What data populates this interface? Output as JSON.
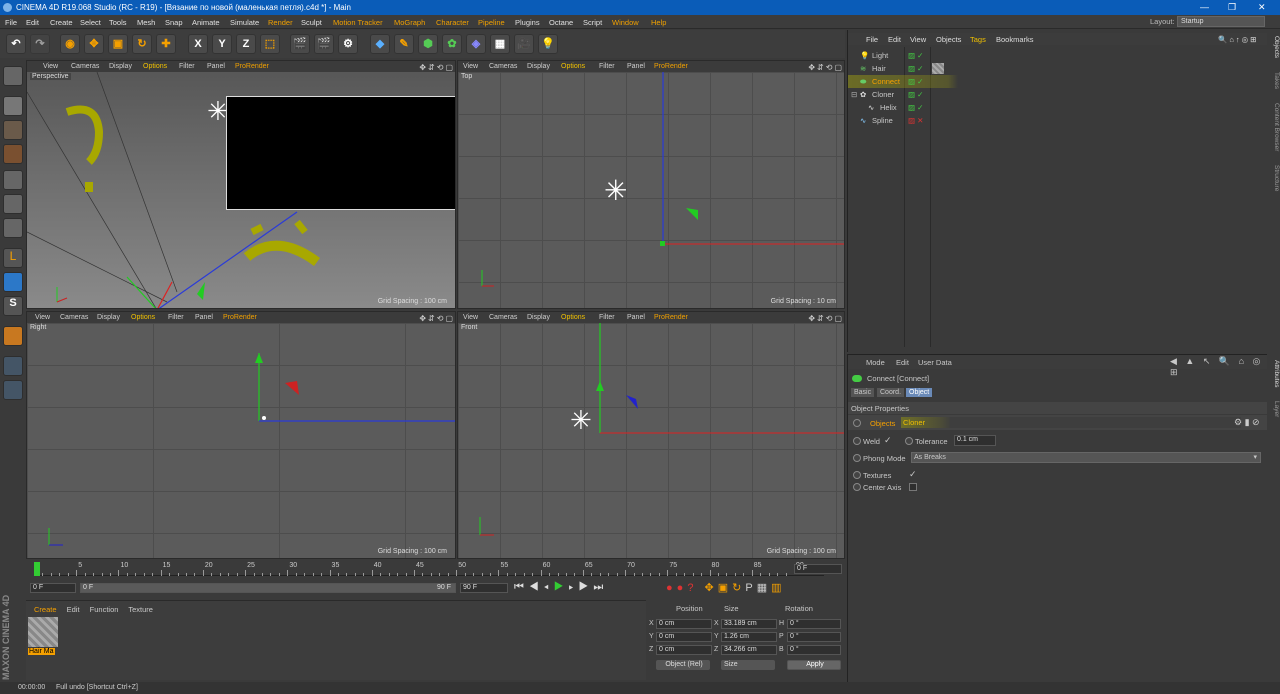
{
  "window": {
    "title": "CINEMA 4D R19.068 Studio (RC - R19) - [Вязание по новой (маленькая петля).c4d *] - Main",
    "controls": [
      "—",
      "❐",
      "✕"
    ]
  },
  "menubar": {
    "items": [
      "File",
      "Edit",
      "Create",
      "Select",
      "Tools",
      "Mesh",
      "Snap",
      "Animate",
      "Simulate",
      "Render",
      "Sculpt",
      "Motion Tracker",
      "MoGraph",
      "Character",
      "Pipeline",
      "Plugins",
      "Octane",
      "Script",
      "Window",
      "Help"
    ],
    "layout_label": "Layout:",
    "layout_value": "Startup"
  },
  "toolbar": {
    "axis_labels": [
      "X",
      "Y",
      "Z"
    ]
  },
  "viewports": [
    {
      "name": "Perspective",
      "menu": [
        "View",
        "Cameras",
        "Display",
        "Options",
        "Filter",
        "Panel",
        "ProRender"
      ],
      "grid_spacing": "Grid Spacing : 100 cm"
    },
    {
      "name": "Top",
      "menu": [
        "View",
        "Cameras",
        "Display",
        "Options",
        "Filter",
        "Panel",
        "ProRender"
      ],
      "grid_spacing": "Grid Spacing : 10 cm"
    },
    {
      "name": "Right",
      "menu": [
        "View",
        "Cameras",
        "Display",
        "Options",
        "Filter",
        "Panel",
        "ProRender"
      ],
      "grid_spacing": "Grid Spacing : 100 cm"
    },
    {
      "name": "Front",
      "menu": [
        "View",
        "Cameras",
        "Display",
        "Options",
        "Filter",
        "Panel",
        "ProRender"
      ],
      "grid_spacing": "Grid Spacing : 100 cm"
    }
  ],
  "timeline": {
    "ticks": [
      "0",
      "5",
      "10",
      "15",
      "20",
      "25",
      "30",
      "35",
      "40",
      "45",
      "50",
      "55",
      "60",
      "65",
      "70",
      "75",
      "80",
      "85",
      "90"
    ],
    "current_frame": "0 F",
    "start": "0 F",
    "start2": "0 F",
    "end": "90 F",
    "end2": "90 F"
  },
  "material_manager": {
    "menu": [
      "Create",
      "Edit",
      "Function",
      "Texture"
    ],
    "materials": [
      {
        "name": "Hair Ma"
      }
    ]
  },
  "coordinates": {
    "headers": [
      "Position",
      "Size",
      "Rotation"
    ],
    "rows": [
      {
        "axis": "X",
        "pos": "0 cm",
        "saxis": "X",
        "size": "33.189 cm",
        "raxis": "H",
        "rot": "0 °"
      },
      {
        "axis": "Y",
        "pos": "0 cm",
        "saxis": "Y",
        "size": "1.26 cm",
        "raxis": "P",
        "rot": "0 °"
      },
      {
        "axis": "Z",
        "pos": "0 cm",
        "saxis": "Z",
        "size": "34.266 cm",
        "raxis": "B",
        "rot": "0 °"
      }
    ],
    "mode": "Object (Rel)",
    "size_mode": "Size",
    "apply": "Apply"
  },
  "object_manager": {
    "menu": [
      "File",
      "Edit",
      "View",
      "Objects",
      "Tags",
      "Bookmarks"
    ],
    "objects": [
      {
        "name": "Light"
      },
      {
        "name": "Hair"
      },
      {
        "name": "Connect"
      },
      {
        "name": "Cloner"
      },
      {
        "name": "Helix"
      },
      {
        "name": "Spline"
      }
    ]
  },
  "attributes": {
    "menu": [
      "Mode",
      "Edit",
      "User Data"
    ],
    "object_title": "Connect [Connect]",
    "tabs": [
      "Basic",
      "Coord.",
      "Object"
    ],
    "section": "Object Properties",
    "objects_label": "Objects",
    "objects_value": "Cloner",
    "weld_label": "Weld",
    "weld_check": "✓",
    "tolerance_label": "Tolerance",
    "tolerance_value": "0.1 cm",
    "phong_label": "Phong Mode",
    "phong_value": "As Breaks",
    "textures_label": "Textures",
    "textures_check": "✓",
    "center_axis_label": "Center Axis"
  },
  "side_tabs_right": [
    "Objects",
    "Takes",
    "Content Browser",
    "Structure"
  ],
  "side_tabs_right2": [
    "Attributes",
    "Layer"
  ],
  "statusbar": {
    "time": "00:00:00",
    "message": "Full undo [Shortcut Ctrl+Z]"
  },
  "brand": "MAXON CINEMA 4D"
}
